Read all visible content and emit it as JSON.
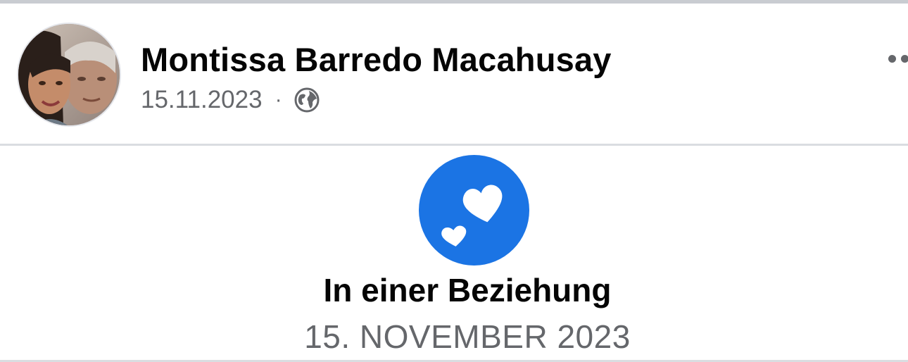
{
  "post": {
    "author_name": "Montissa Barredo Macahusay",
    "date": "15.11.2023",
    "separator": "·",
    "audience_icon": "globe-icon",
    "more_icon": "more-dots-icon"
  },
  "life_event": {
    "icon": "hearts-icon",
    "title": "In einer Beziehung",
    "date": "15. NOVEMBER 2023"
  },
  "colors": {
    "accent": "#1b74e4",
    "text_primary": "#050505",
    "text_secondary": "#65676b",
    "divider": "#dadde1"
  }
}
